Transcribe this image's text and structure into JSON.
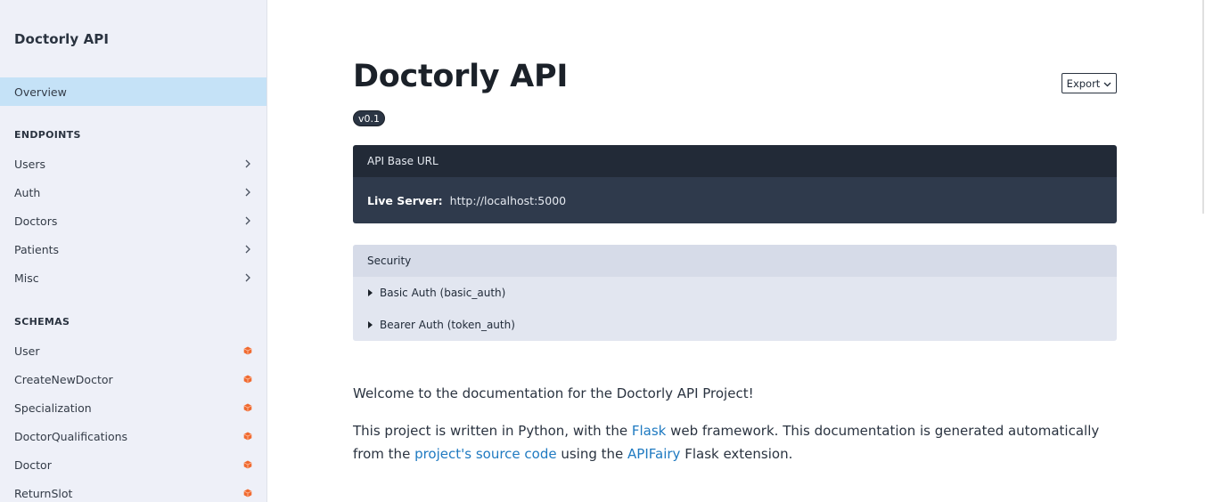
{
  "sidebar": {
    "app_title": "Doctorly API",
    "overview_label": "Overview",
    "endpoints_heading": "ENDPOINTS",
    "endpoints": [
      {
        "label": "Users"
      },
      {
        "label": "Auth"
      },
      {
        "label": "Doctors"
      },
      {
        "label": "Patients"
      },
      {
        "label": "Misc"
      }
    ],
    "schemas_heading": "SCHEMAS",
    "schemas": [
      {
        "label": "User"
      },
      {
        "label": "CreateNewDoctor"
      },
      {
        "label": "Specialization"
      },
      {
        "label": "DoctorQualifications"
      },
      {
        "label": "Doctor"
      },
      {
        "label": "ReturnSlot"
      }
    ],
    "chevron_icon": "chevron-right-icon",
    "schema_icon": "cube-icon",
    "accent_color": "#f06a30"
  },
  "main": {
    "title": "Doctorly API",
    "version": "v0.1",
    "export_label": "Export",
    "base_url": {
      "heading": "API Base URL",
      "server_label": "Live Server:",
      "server_url": "http://localhost:5000"
    },
    "security": {
      "heading": "Security",
      "items": [
        {
          "label": "Basic Auth (basic_auth)"
        },
        {
          "label": "Bearer Auth (token_auth)"
        }
      ]
    },
    "description": {
      "p1": "Welcome to the documentation for the Doctorly API Project!",
      "p2_a": "This project is written in Python, with the ",
      "p2_link1": "Flask",
      "p2_b": " web framework. This documentation is generated automatically from the ",
      "p2_link2": "project's source code",
      "p2_c": " using the ",
      "p2_link3": "APIFairy",
      "p2_d": " Flask extension."
    }
  },
  "colors": {
    "sidebar_bg": "#eef0f8",
    "active_bg": "#c5e2f7",
    "base_url_header": "#222a37",
    "link": "#1f7ac1"
  }
}
